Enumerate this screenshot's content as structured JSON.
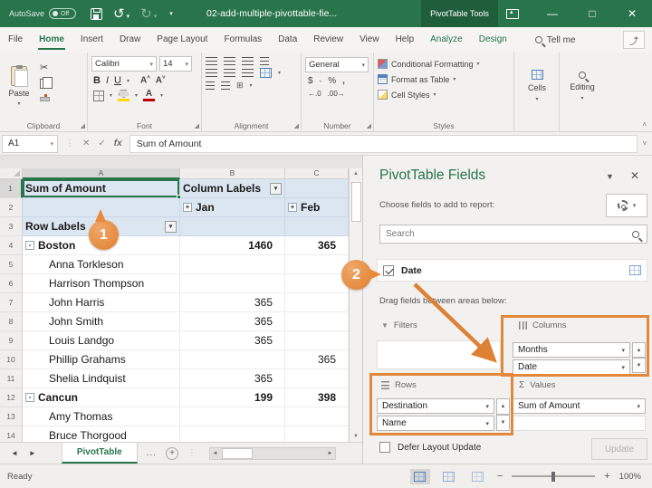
{
  "colors": {
    "excel_green": "#28754c",
    "excel_dark_green": "#1f5e3a",
    "callout_orange": "#e2873b",
    "pivot_header_blue": "#dce6f1"
  },
  "titlebar": {
    "autosave_label": "AutoSave",
    "autosave_state": "Off",
    "title": "02-add-multiple-pivottable-fie...",
    "context_tab": "PivotTable Tools"
  },
  "menubar": {
    "tabs": [
      {
        "label": "File"
      },
      {
        "label": "Home",
        "active": true
      },
      {
        "label": "Insert"
      },
      {
        "label": "Draw"
      },
      {
        "label": "Page Layout"
      },
      {
        "label": "Formulas"
      },
      {
        "label": "Data"
      },
      {
        "label": "Review"
      },
      {
        "label": "View"
      },
      {
        "label": "Help"
      },
      {
        "label": "Analyze",
        "contextual": true
      },
      {
        "label": "Design",
        "contextual": true
      }
    ],
    "tellme_label": "Tell me"
  },
  "ribbon": {
    "clipboard": {
      "paste": "Paste",
      "label": "Clipboard"
    },
    "font": {
      "name": "Calibri",
      "size": "14",
      "bold": "B",
      "italic": "I",
      "underline": "U",
      "label": "Font"
    },
    "alignment": {
      "label": "Alignment"
    },
    "number": {
      "format": "General",
      "label": "Number"
    },
    "styles": {
      "items": [
        "Conditional Formatting",
        "Format as Table",
        "Cell Styles"
      ],
      "label": "Styles"
    },
    "cells": {
      "label": "Cells"
    },
    "editing": {
      "label": "Editing"
    }
  },
  "formula_bar": {
    "name_box": "A1",
    "formula": "Sum of Amount"
  },
  "worksheet": {
    "columns": [
      "A",
      "B",
      "C"
    ],
    "rows": [
      {
        "n": "1",
        "hdr": true,
        "cells": [
          {
            "t": "Sum of Amount",
            "bold": true,
            "sel": true
          },
          {
            "t": "Column Labels",
            "bold": true,
            "dd": true
          },
          {
            "t": ""
          }
        ]
      },
      {
        "n": "2",
        "hdr": true,
        "cells": [
          {
            "t": ""
          },
          {
            "t": "Jan",
            "bold": true,
            "exp": "+"
          },
          {
            "t": "Feb",
            "bold": true,
            "exp": "+"
          }
        ]
      },
      {
        "n": "3",
        "hdr": true,
        "cells": [
          {
            "t": "Row Labels",
            "bold": true,
            "dd": true
          },
          {
            "t": ""
          },
          {
            "t": ""
          }
        ]
      },
      {
        "n": "4",
        "cells": [
          {
            "t": "Boston",
            "bold": true,
            "exp": "-"
          },
          {
            "t": "1460",
            "bold": true,
            "num": true
          },
          {
            "t": "365",
            "bold": true,
            "num": true
          }
        ]
      },
      {
        "n": "5",
        "cells": [
          {
            "t": "Anna Torkleson",
            "ind": true
          },
          {
            "t": ""
          },
          {
            "t": ""
          }
        ]
      },
      {
        "n": "6",
        "cells": [
          {
            "t": "Harrison Thompson",
            "ind": true
          },
          {
            "t": ""
          },
          {
            "t": ""
          }
        ]
      },
      {
        "n": "7",
        "cells": [
          {
            "t": "John Harris",
            "ind": true
          },
          {
            "t": "365",
            "num": true
          },
          {
            "t": ""
          }
        ]
      },
      {
        "n": "8",
        "cells": [
          {
            "t": "John Smith",
            "ind": true
          },
          {
            "t": "365",
            "num": true
          },
          {
            "t": ""
          }
        ]
      },
      {
        "n": "9",
        "cells": [
          {
            "t": "Louis Landgo",
            "ind": true
          },
          {
            "t": "365",
            "num": true
          },
          {
            "t": ""
          }
        ]
      },
      {
        "n": "10",
        "cells": [
          {
            "t": "Phillip Grahams",
            "ind": true
          },
          {
            "t": ""
          },
          {
            "t": "365",
            "num": true
          }
        ]
      },
      {
        "n": "11",
        "cells": [
          {
            "t": "Shelia Lindquist",
            "ind": true
          },
          {
            "t": "365",
            "num": true
          },
          {
            "t": ""
          }
        ]
      },
      {
        "n": "12",
        "cells": [
          {
            "t": "Cancun",
            "bold": true,
            "exp": "-"
          },
          {
            "t": "199",
            "bold": true,
            "num": true
          },
          {
            "t": "398",
            "bold": true,
            "num": true
          }
        ]
      },
      {
        "n": "13",
        "cells": [
          {
            "t": "Amy Thomas",
            "ind": true
          },
          {
            "t": ""
          },
          {
            "t": ""
          }
        ]
      },
      {
        "n": "14",
        "cells": [
          {
            "t": "Bruce Thorgood",
            "ind": true
          },
          {
            "t": ""
          },
          {
            "t": ""
          }
        ]
      }
    ]
  },
  "sheet_tabs": {
    "active": "PivotTable",
    "more_label": "...",
    "add_label": "+"
  },
  "fields_pane": {
    "title": "PivotTable Fields",
    "choose_label": "Choose fields to add to report:",
    "search_placeholder": "Search",
    "fields": [
      {
        "name": "Date",
        "checked": true
      }
    ],
    "drag_label": "Drag fields between areas below:",
    "areas": {
      "filters": {
        "label": "Filters",
        "items": []
      },
      "columns": {
        "label": "Columns",
        "items": [
          "Months",
          "Date"
        ]
      },
      "rows": {
        "label": "Rows",
        "items": [
          "Destination",
          "Name"
        ]
      },
      "values": {
        "label": "Values",
        "items": [
          "Sum of Amount"
        ]
      }
    },
    "defer_label": "Defer Layout Update",
    "update_label": "Update"
  },
  "status_bar": {
    "status": "Ready",
    "zoom": "100%"
  },
  "callouts": {
    "one": "1",
    "two": "2"
  }
}
